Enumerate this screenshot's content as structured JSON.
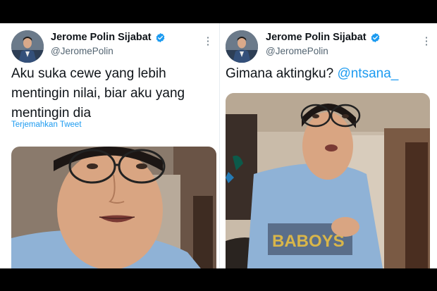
{
  "tweets": [
    {
      "display_name": "Jerome Polin Sijabat",
      "handle": "@JeromePolin",
      "text": "Aku suka cewe yang lebih mentingin nilai, biar aku yang mentingin dia",
      "translate_label": "Terjemahkan Tweet"
    },
    {
      "display_name": "Jerome Polin Sijabat",
      "handle": "@JeromePolin",
      "text": "Gimana aktingku?",
      "mention": "@ntsana_"
    }
  ],
  "shirt_print": "BABOYS",
  "icons": [
    "verified-badge-icon",
    "more-options-icon",
    "app-logo-icon"
  ],
  "colors": {
    "link": "#1d9bf0",
    "text": "#0f1419",
    "secondary": "#536471",
    "verified": "#1d9bf0"
  }
}
